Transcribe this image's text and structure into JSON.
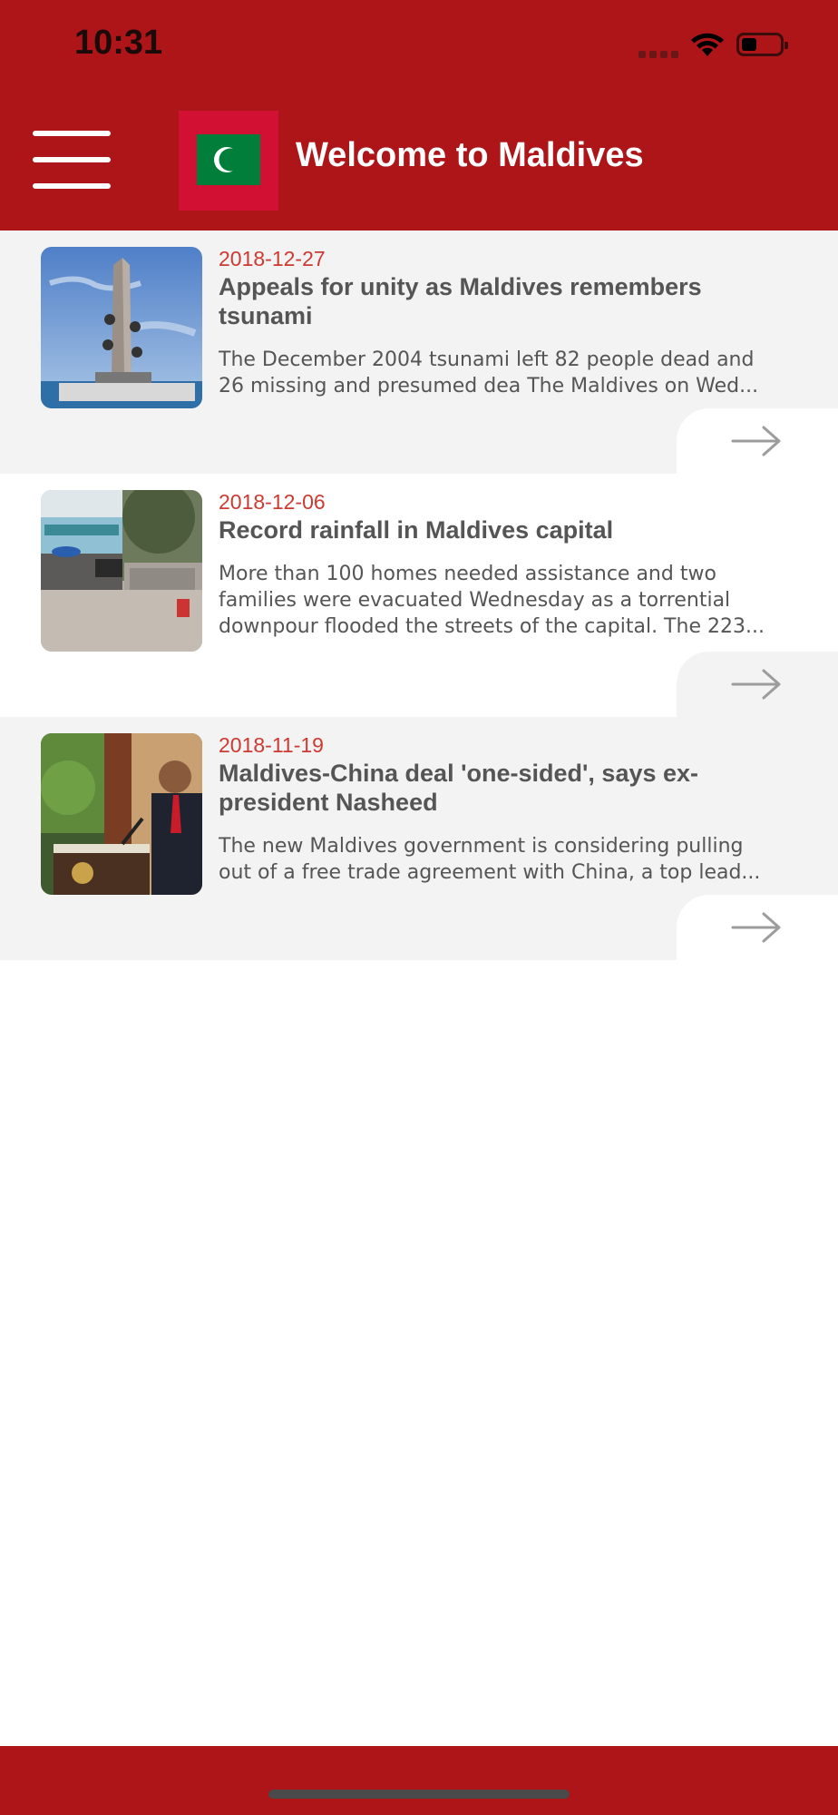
{
  "status_bar": {
    "time": "10:31",
    "icons": [
      "signal-icon",
      "wifi-icon",
      "battery-icon"
    ]
  },
  "header": {
    "title": "Welcome to Maldives",
    "menu_icon": "hamburger-menu-icon",
    "flag": "maldives-flag",
    "background_color": "#ad1518"
  },
  "news": [
    {
      "date": "2018-12-27",
      "headline": "Appeals for unity as Maldives remembers tsunami",
      "summary_lines": [
        "The December 2004 tsunami left 82 people dead and",
        "26 missing and presumed dea The Maldives on Wed..."
      ],
      "image": "tsunami-memorial-monument",
      "action_icon": "arrow-right-icon"
    },
    {
      "date": "2018-12-06",
      "headline": "Record rainfall in Maldives capital",
      "summary_lines": [
        "More than 100 homes needed assistance and two",
        "families were evacuated Wednesday as a torrential",
        "downpour flooded the streets of the capital. The 223..."
      ],
      "image": "flooded-street",
      "action_icon": "arrow-right-icon"
    },
    {
      "date": "2018-11-19",
      "headline": "Maldives-China deal 'one-sided', says ex-president Nasheed",
      "summary_lines": [
        "The new Maldives government is considering pulling",
        "out of a free trade agreement with China, a top lead..."
      ],
      "image": "president-at-podium",
      "action_icon": "arrow-right-icon"
    }
  ],
  "colors": {
    "brand_red": "#ad1518",
    "date_red": "#cc3a31",
    "text_gray": "#555555",
    "row_gray": "#f3f3f3",
    "flag_red": "#d21034",
    "flag_green": "#007e3a"
  }
}
